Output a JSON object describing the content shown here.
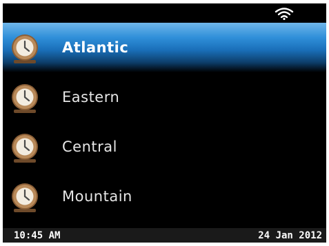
{
  "status_bar": {
    "wifi_icon": "wifi-icon"
  },
  "menu": {
    "items": [
      {
        "label": "Atlantic",
        "icon": "clock-icon",
        "selected": true
      },
      {
        "label": "Eastern",
        "icon": "clock-icon",
        "selected": false
      },
      {
        "label": "Central",
        "icon": "clock-icon",
        "selected": false
      },
      {
        "label": "Mountain",
        "icon": "clock-icon",
        "selected": false
      }
    ]
  },
  "footer": {
    "time": "10:45 AM",
    "date": "24 Jan 2012"
  },
  "colors": {
    "selection": "#2f8fd9",
    "background": "#000000",
    "clock_case": "#a97a4c"
  }
}
